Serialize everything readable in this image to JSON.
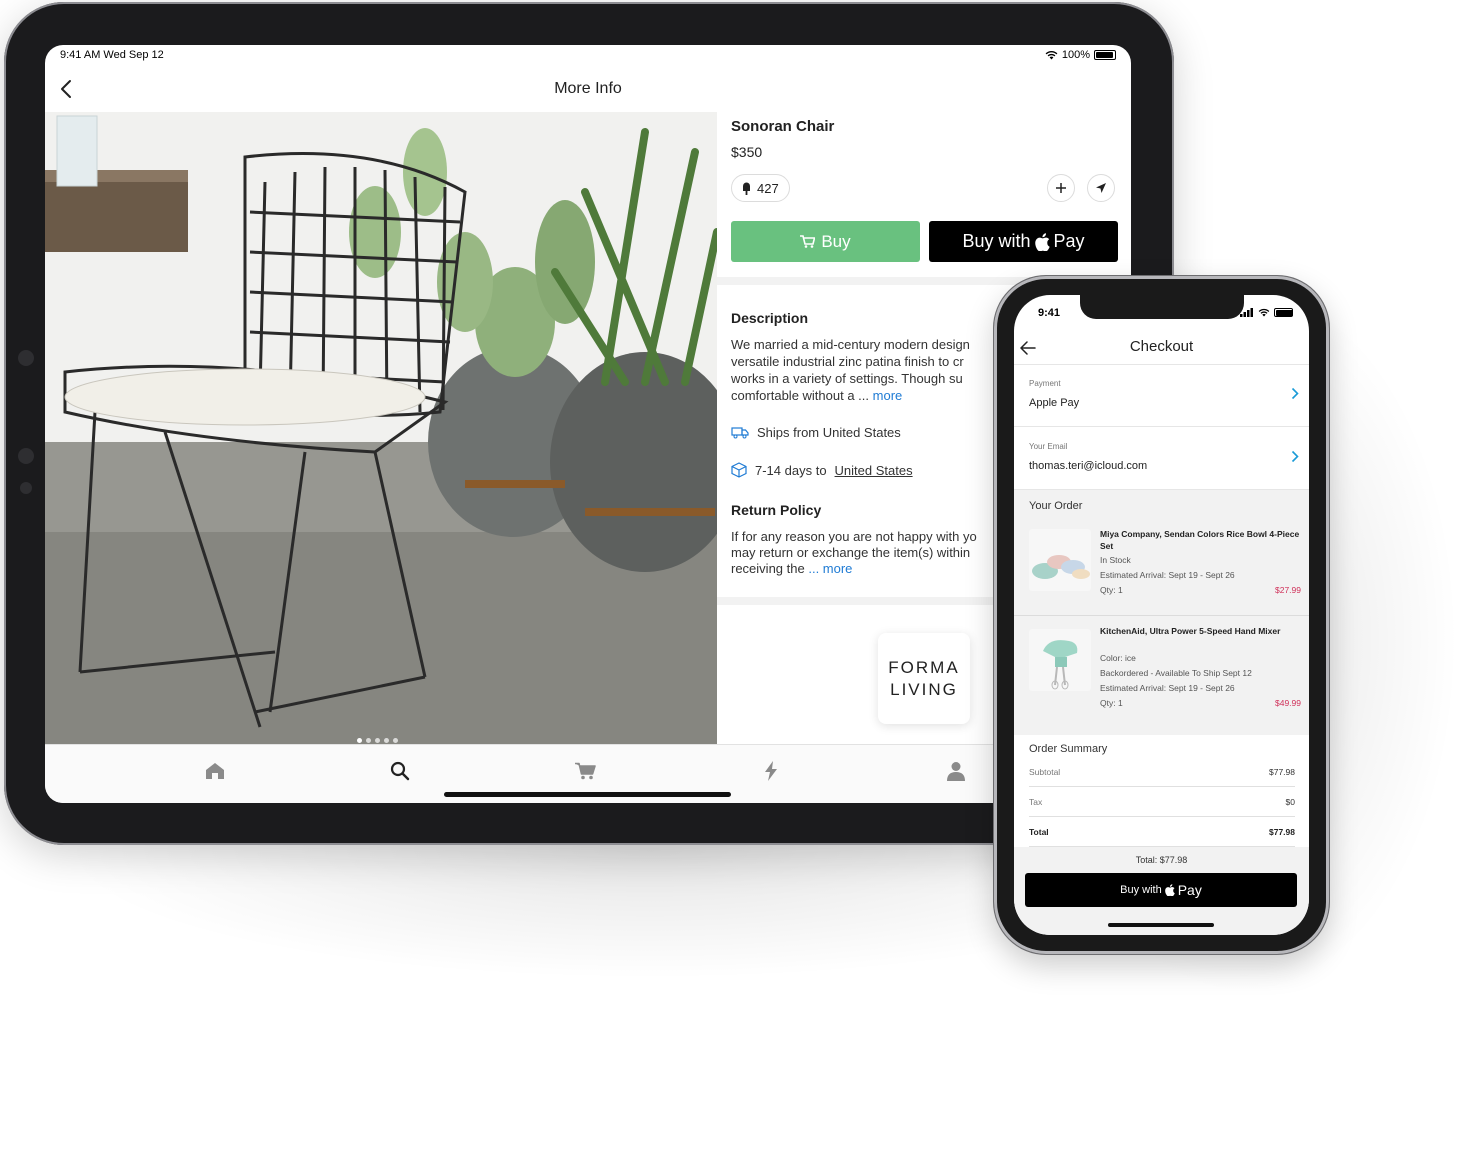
{
  "ipad": {
    "status_time": "9:41 AM   Wed Sep 12",
    "status_battery": "100%",
    "nav_title": "More Info",
    "product": {
      "name": "Sonoran Chair",
      "price": "$350",
      "likes": "427"
    },
    "buy_label": "Buy",
    "applepay_prefix": "Buy with",
    "applepay_suffix": "Pay",
    "description": {
      "title": "Description",
      "line1": "We married a mid-century modern design",
      "line2": "versatile industrial zinc patina finish to cr",
      "line3": "works in a variety of settings. Though su",
      "line4": "comfortable without a ...",
      "more": "more"
    },
    "ships_from": "Ships from United States",
    "delivery_prefix": "7-14 days to",
    "delivery_place": "United States",
    "return_policy": {
      "title": "Return Policy",
      "line1": "If for any reason you are not happy with yo",
      "line2": "may return or exchange the item(s) within",
      "line3": "receiving the",
      "more": "... more"
    },
    "brand": {
      "line1": "FORMA",
      "line2": "LIVING"
    },
    "tabs": [
      "home-icon",
      "search-icon",
      "cart-icon",
      "bolt-icon",
      "profile-icon"
    ],
    "photo_pages": 5,
    "photo_active_page": 1
  },
  "iphone": {
    "status_time": "9:41",
    "nav_title": "Checkout",
    "payment": {
      "label": "Payment",
      "value": "Apple Pay"
    },
    "email": {
      "label": "Your Email",
      "value": "thomas.teri@icloud.com"
    },
    "order_title": "Your Order",
    "items": [
      {
        "name": "Miya Company, Sendan Colors Rice Bowl 4-Piece Set",
        "line1": "In Stock",
        "line2": "Estimated Arrival: Sept 19 - Sept 26",
        "line3": "Qty: 1",
        "price": "$27.99"
      },
      {
        "name": "KitchenAid, Ultra Power 5-Speed Hand Mixer",
        "line1": "Color: ice",
        "line2": "Backordered - Available To Ship Sept 12",
        "line3": "Estimated Arrival: Sept 19 - Sept 26",
        "line4": "Qty: 1",
        "price": "$49.99"
      }
    ],
    "summary": {
      "title": "Order Summary",
      "subtotal_label": "Subtotal",
      "subtotal_value": "$77.98",
      "tax_label": "Tax",
      "tax_value": "$0",
      "total_label": "Total",
      "total_value": "$77.98"
    },
    "footer_total": "Total: $77.98",
    "pay_prefix": "Buy with",
    "pay_suffix": "Pay"
  },
  "colors": {
    "buy_green": "#69c17f",
    "link_blue": "#1f7bd4",
    "chevron_teal": "#1a9bd7",
    "price_red": "#d0315a"
  }
}
